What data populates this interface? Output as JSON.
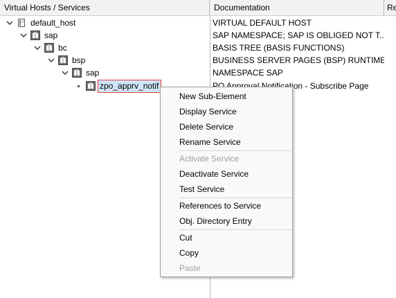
{
  "header": {
    "col1": "Virtual Hosts / Services",
    "col2": "Documentation",
    "col3": "Re"
  },
  "tree": [
    {
      "label": "default_host",
      "icon": "host-icon"
    },
    {
      "label": "sap",
      "icon": "service-folder-icon"
    },
    {
      "label": "bc",
      "icon": "service-folder-icon"
    },
    {
      "label": "bsp",
      "icon": "service-folder-icon"
    },
    {
      "label": "sap",
      "icon": "service-folder-icon"
    },
    {
      "label": "zpo_apprv_notif",
      "icon": "service-node-icon"
    }
  ],
  "documentation": [
    "VIRTUAL DEFAULT HOST",
    "SAP NAMESPACE; SAP IS OBLIGED NOT T...",
    "BASIS TREE (BASIS FUNCTIONS)",
    "BUSINESS SERVER PAGES (BSP) RUNTIME",
    "NAMESPACE SAP",
    "PO Approval Notification - Subscribe Page"
  ],
  "menu": {
    "new_sub": "New Sub-Element",
    "display": "Display Service",
    "delete": "Delete Service",
    "rename": "Rename Service",
    "activate": "Activate Service",
    "deactivate": "Deactivate Service",
    "test": "Test Service",
    "references": "References to Service",
    "objdir": "Obj. Directory Entry",
    "cut": "Cut",
    "copy": "Copy",
    "paste": "Paste"
  },
  "colors": {
    "selection_bg": "#cfe5f7",
    "selection_border": "#e23b3b",
    "disabled_text": "#a0a0a0"
  }
}
